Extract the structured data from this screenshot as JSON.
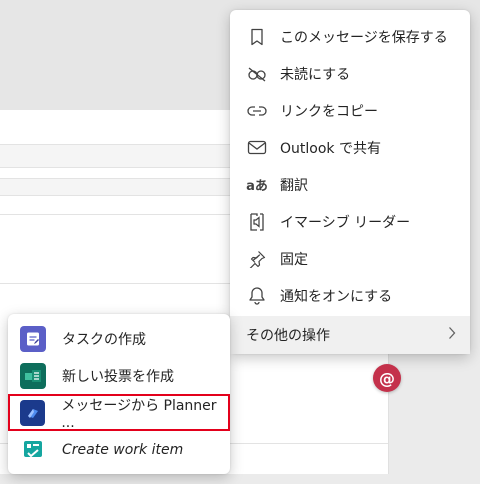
{
  "context_menu": {
    "items": [
      {
        "label": "このメッセージを保存する",
        "icon": "bookmark-icon"
      },
      {
        "label": "未読にする",
        "icon": "unread-icon"
      },
      {
        "label": "リンクをコピー",
        "icon": "link-icon"
      },
      {
        "label": "Outlook で共有",
        "icon": "mail-icon"
      },
      {
        "label": "翻訳",
        "icon": "translate-icon"
      },
      {
        "label": "イマーシブ リーダー",
        "icon": "immersive-reader-icon"
      },
      {
        "label": "固定",
        "icon": "pin-icon"
      },
      {
        "label": "通知をオンにする",
        "icon": "bell-icon"
      }
    ],
    "more_actions": {
      "label": "その他の操作",
      "icon": "chevron-right-icon"
    }
  },
  "submenu": {
    "items": [
      {
        "label": "タスクの作成",
        "icon": "tasks-app-icon",
        "color": "#5b5fc7"
      },
      {
        "label": "新しい投票を作成",
        "icon": "forms-app-icon",
        "color": "#0e6e5c"
      },
      {
        "label": "メッセージから Planner ...",
        "icon": "planner-app-icon",
        "color": "#1b3a8c"
      },
      {
        "label": "Create work item",
        "icon": "azure-boards-icon",
        "color": "#15a6a0"
      }
    ]
  },
  "mention_badge": {
    "label": "@",
    "color": "#c4314b"
  },
  "highlight_color": "#e3001b"
}
